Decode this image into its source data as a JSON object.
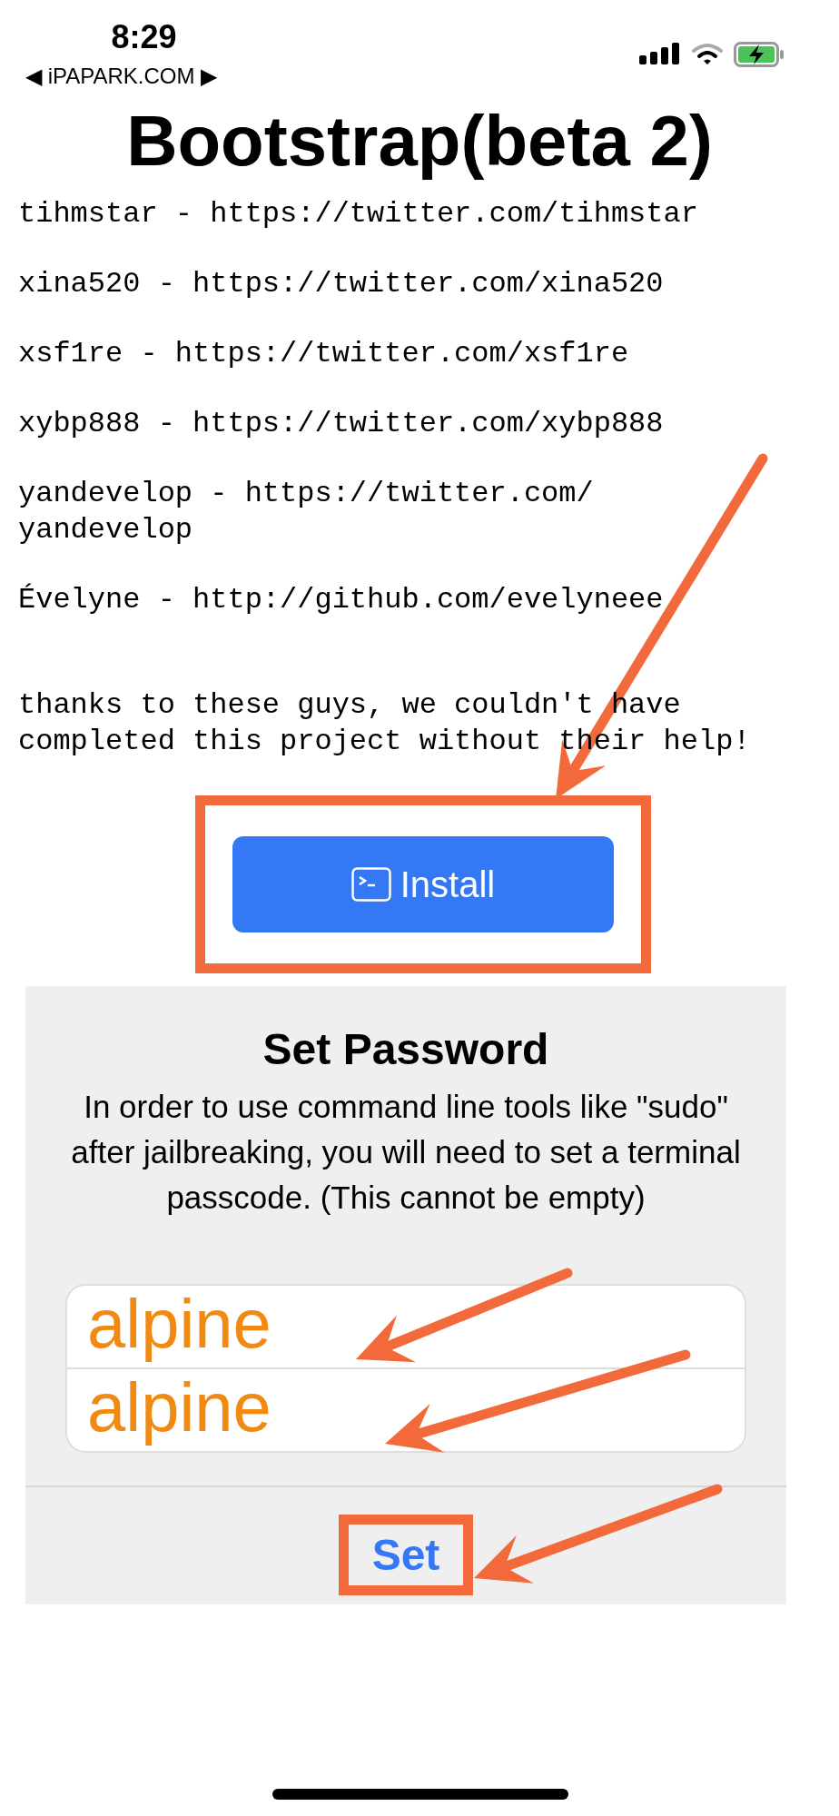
{
  "status_bar": {
    "time": "8:29",
    "back_link": "◀ iPAPARK.COM ▶"
  },
  "title": "Bootstrap(beta 2)",
  "credits": [
    {
      "kind": "credit",
      "lines": [
        "tihmstar - https://twitter.com/tihmstar"
      ]
    },
    {
      "kind": "credit",
      "lines": [
        "xina520 - https://twitter.com/xina520"
      ]
    },
    {
      "kind": "credit",
      "lines": [
        "xsf1re - https://twitter.com/xsf1re"
      ]
    },
    {
      "kind": "credit",
      "lines": [
        "xybp888 - https://twitter.com/xybp888"
      ]
    },
    {
      "kind": "credit",
      "lines": [
        "yandevelop - https://twitter.com/",
        "yandevelop"
      ]
    },
    {
      "kind": "credit",
      "lines": [
        "Évelyne - http://github.com/evelyneee"
      ]
    },
    {
      "kind": "note",
      "lines": [
        "thanks to these guys, we couldn't have",
        "completed this project without their help!"
      ]
    }
  ],
  "install_button": {
    "label": "Install"
  },
  "dialog": {
    "title": "Set Password",
    "message": "In order to use command line tools like \"sudo\" after jailbreaking, you will need to set a terminal passcode. (This cannot be empty)",
    "fields": [
      {
        "annotation": "alpine"
      },
      {
        "annotation": "alpine"
      }
    ],
    "button": "Set"
  }
}
